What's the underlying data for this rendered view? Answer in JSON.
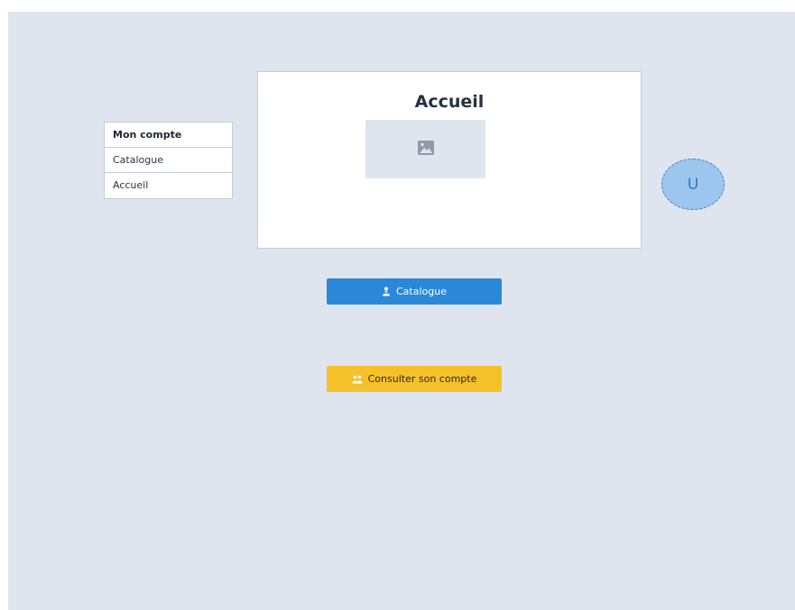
{
  "nav": {
    "items": [
      {
        "label": "Mon compte",
        "active": true
      },
      {
        "label": "Catalogue",
        "active": false
      },
      {
        "label": "Accueil",
        "active": false
      }
    ]
  },
  "panel": {
    "title": "Accueil",
    "image_icon": "image-icon"
  },
  "avatar": {
    "initial": "U"
  },
  "buttons": {
    "catalogue": {
      "label": "Catalogue",
      "icon": "person-icon"
    },
    "account": {
      "label": "Consulter son compte",
      "icon": "users-icon"
    }
  },
  "colors": {
    "background": "#dfe5ee",
    "primary": "#2b88d8",
    "warning": "#f5c12a",
    "avatar": "#9dc6ef"
  }
}
